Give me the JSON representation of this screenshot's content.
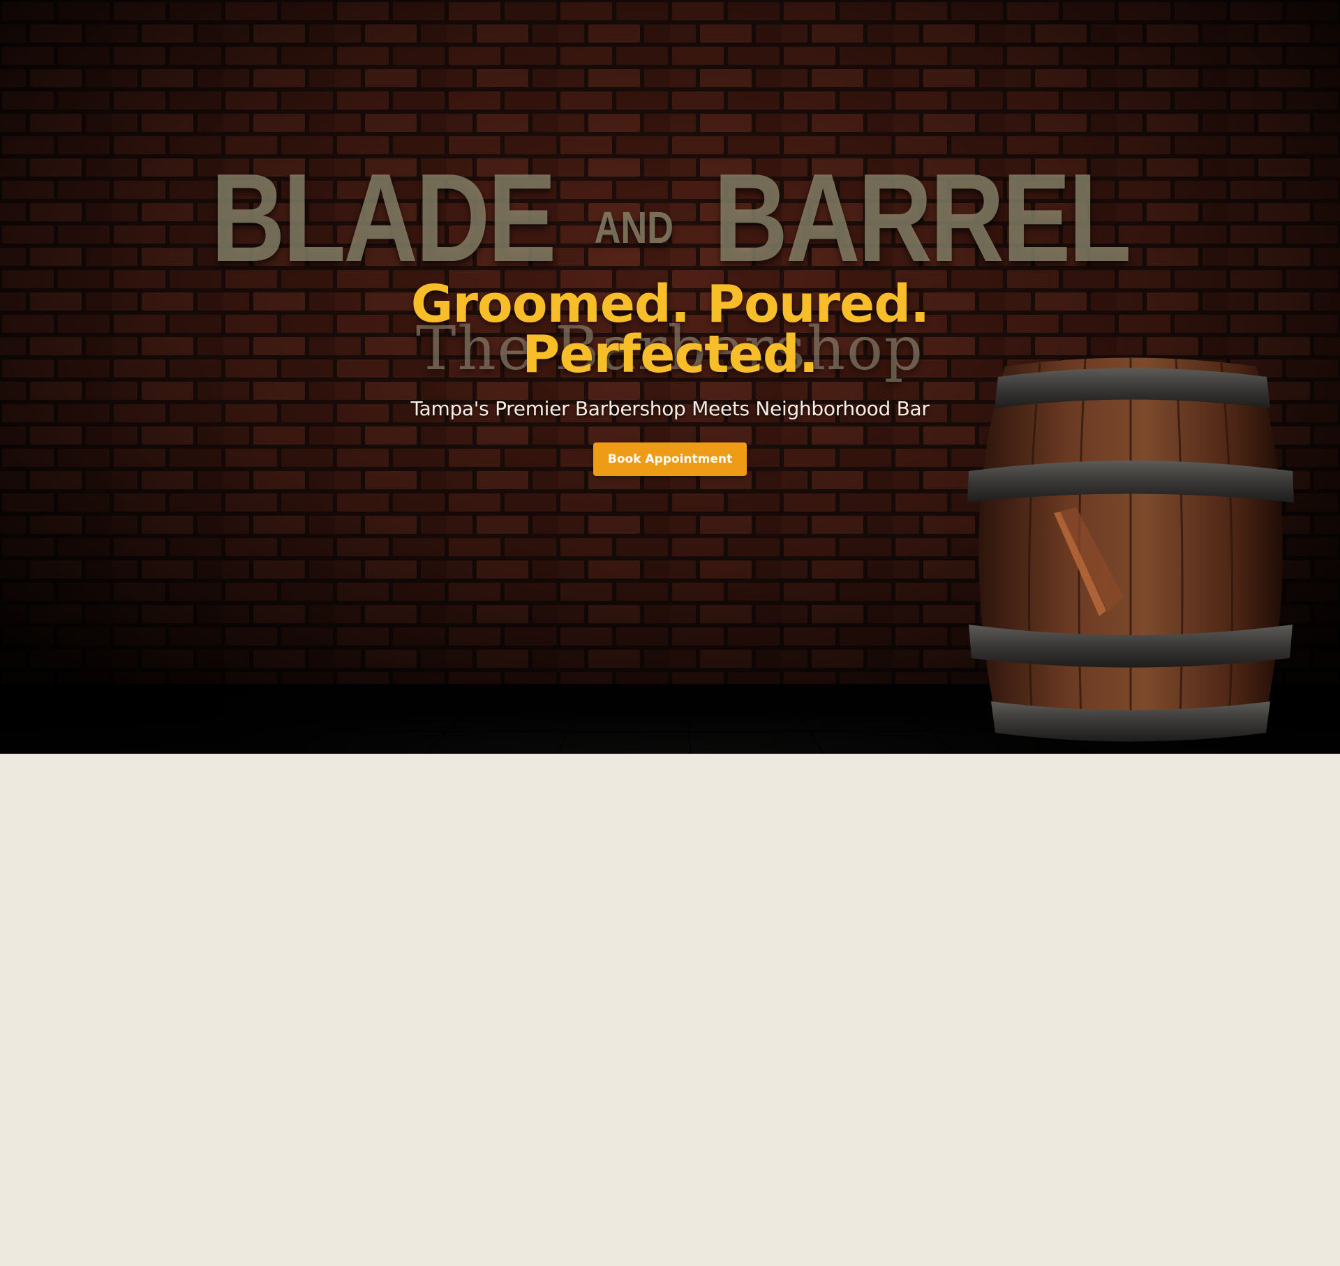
{
  "hero": {
    "sign": {
      "word_left": "BLADE",
      "word_and": "AND",
      "word_right": "BARREL",
      "subtitle": "The Barbershop"
    },
    "headline_line1": "Groomed. Poured.",
    "headline_line2": "Perfected.",
    "tagline": "Tampa's Premier Barbershop Meets Neighborhood Bar",
    "cta_label": "Book Appointment"
  },
  "colors": {
    "accent": "#ee9b15",
    "headline": "#f7be2a",
    "lower_background": "#ede9df",
    "hero_background": "#0a0605"
  },
  "icons": {
    "barrel": "barrel-illustration",
    "razor": "straight-razor-icon"
  }
}
